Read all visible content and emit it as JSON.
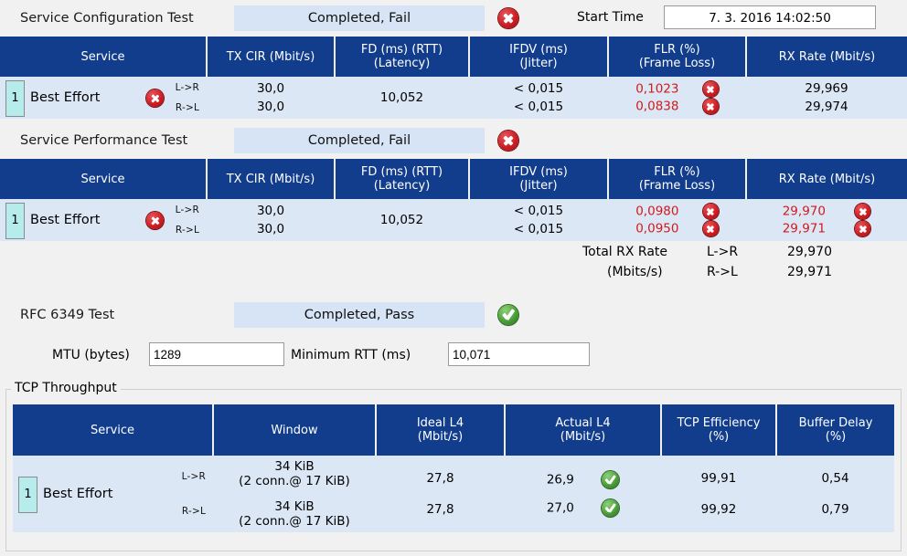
{
  "sections": {
    "service_config": {
      "title": "Service Configuration Test",
      "status": "Completed, Fail",
      "status_icon": "fail-icon",
      "start_time_label": "Start Time",
      "start_time_value": "7. 3. 2016 14:02:50",
      "columns": [
        "Service",
        "TX CIR (Mbit/s)",
        "FD (ms) (RTT)\n(Latency)",
        "IFDV (ms)\n(Jitter)",
        "FLR (%)\n(Frame Loss)",
        "RX Rate (Mbit/s)"
      ],
      "col_headers": {
        "service": "Service",
        "tx_cir": "TX CIR (Mbit/s)",
        "fd_l1": "FD (ms) (RTT)",
        "fd_l2": "(Latency)",
        "ifdv_l1": "IFDV (ms)",
        "ifdv_l2": "(Jitter)",
        "flr_l1": "FLR (%)",
        "flr_l2": "(Frame Loss)",
        "rx_rate": "RX Rate (Mbit/s)"
      },
      "row": {
        "index": "1",
        "service": "Best Effort",
        "service_icon": "fail-icon",
        "dir_top": "L->R",
        "dir_bot": "R->L",
        "tx_cir_top": "30,0",
        "tx_cir_bot": "30,0",
        "fd": "10,052",
        "ifdv_top": "< 0,015",
        "ifdv_bot": "< 0,015",
        "flr_top": "0,1023",
        "flr_bot": "0,0838",
        "flr_top_icon": "fail-icon",
        "flr_bot_icon": "fail-icon",
        "rx_top": "29,969",
        "rx_bot": "29,974"
      }
    },
    "service_performance": {
      "title": "Service Performance Test",
      "status": "Completed, Fail",
      "status_icon": "fail-icon",
      "col_headers": {
        "service": "Service",
        "tx_cir": "TX CIR (Mbit/s)",
        "fd_l1": "FD (ms) (RTT)",
        "fd_l2": "(Latency)",
        "ifdv_l1": "IFDV (ms)",
        "ifdv_l2": "(Jitter)",
        "flr_l1": "FLR (%)",
        "flr_l2": "(Frame Loss)",
        "rx_rate": "RX Rate (Mbit/s)"
      },
      "row": {
        "index": "1",
        "service": "Best Effort",
        "service_icon": "fail-icon",
        "dir_top": "L->R",
        "dir_bot": "R->L",
        "tx_cir_top": "30,0",
        "tx_cir_bot": "30,0",
        "fd": "10,052",
        "ifdv_top": "< 0,015",
        "ifdv_bot": "< 0,015",
        "flr_top": "0,0980",
        "flr_bot": "0,0950",
        "flr_top_icon": "fail-icon",
        "flr_bot_icon": "fail-icon",
        "rx_top": "29,970",
        "rx_bot": "29,971",
        "rx_top_icon": "fail-icon",
        "rx_bot_icon": "fail-icon"
      },
      "totals": {
        "label_l1": "Total RX Rate",
        "label_l2": "(Mbits/s)",
        "dir_top": "L->R",
        "dir_bot": "R->L",
        "value_top": "29,970",
        "value_bot": "29,971"
      }
    },
    "rfc6349": {
      "title": "RFC 6349 Test",
      "status": "Completed, Pass",
      "status_icon": "pass-icon",
      "mtu_label": "MTU (bytes)",
      "mtu_value": "1289",
      "min_rtt_label": "Minimum RTT (ms)",
      "min_rtt_value": "10,071"
    },
    "tcp_throughput": {
      "group_title": "TCP Throughput",
      "col_headers": {
        "service": "Service",
        "window": "Window",
        "ideal_l1": "Ideal L4",
        "ideal_l2": "(Mbit/s)",
        "actual_l1": "Actual L4",
        "actual_l2": "(Mbit/s)",
        "eff_l1": "TCP Efficiency",
        "eff_l2": "(%)",
        "buf_l1": "Buffer Delay",
        "buf_l2": "(%)"
      },
      "row": {
        "index": "1",
        "service": "Best Effort",
        "dir_top": "L->R",
        "dir_bot": "R->L",
        "window_top_l1": "34 KiB",
        "window_top_l2": "(2 conn.@ 17 KiB)",
        "window_bot_l1": "34 KiB",
        "window_bot_l2": "(2 conn.@ 17 KiB)",
        "ideal_top": "27,8",
        "ideal_bot": "27,8",
        "actual_top": "26,9",
        "actual_bot": "27,0",
        "actual_top_icon": "pass-icon",
        "actual_bot_icon": "pass-icon",
        "eff_top": "99,91",
        "eff_bot": "99,92",
        "buf_top": "0,54",
        "buf_bot": "0,79"
      }
    }
  },
  "colors": {
    "header_blue": "#113d8c",
    "row_blue": "#dce7f6",
    "status_blue": "#d6e4f5",
    "fail_red": "#d11a1a",
    "index_cyan": "#b6ecec",
    "page_bg": "#f1f1f1"
  }
}
